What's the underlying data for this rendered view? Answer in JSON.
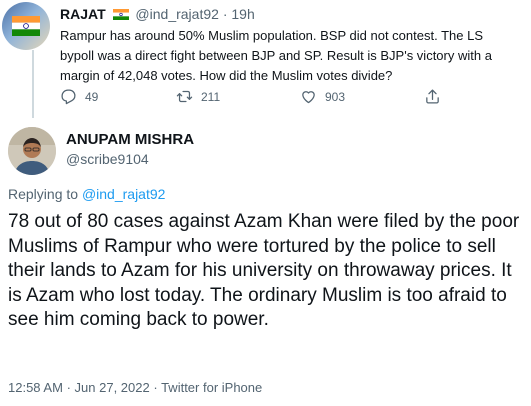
{
  "parent_tweet": {
    "name": "RAJAT",
    "handle": "@ind_rajat92",
    "separator": "·",
    "time": "19h",
    "text": "Rampur has around 50% Muslim population. BSP did not contest. The LS bypoll was a direct fight between BJP and SP. Result is BJP's victory with a margin of 42,048 votes. How did the Muslim votes divide?",
    "reply_count": "49",
    "retweet_count": "211",
    "like_count": "903"
  },
  "main_tweet": {
    "name": "ANUPAM MISHRA",
    "handle": "@scribe9104",
    "replying_prefix": "Replying to",
    "replying_to": "@ind_rajat92",
    "text": "78 out of 80 cases against Azam Khan were filed by the poor Muslims of Rampur who were tortured by the police to sell their lands to Azam for his university on throwaway prices. It is Azam who lost today. The ordinary Muslim is too afraid to see him coming back to power.",
    "time": "12:58 AM",
    "date": "Jun 27, 2022",
    "source": "Twitter for iPhone",
    "separator": "·"
  },
  "colors": {
    "text": "#0f1419",
    "secondary": "#536471",
    "link": "#1d9bf0",
    "thread_line": "#cfd9de"
  },
  "icons": [
    "india-flag-icon",
    "reply-icon",
    "retweet-icon",
    "like-icon",
    "share-icon"
  ]
}
